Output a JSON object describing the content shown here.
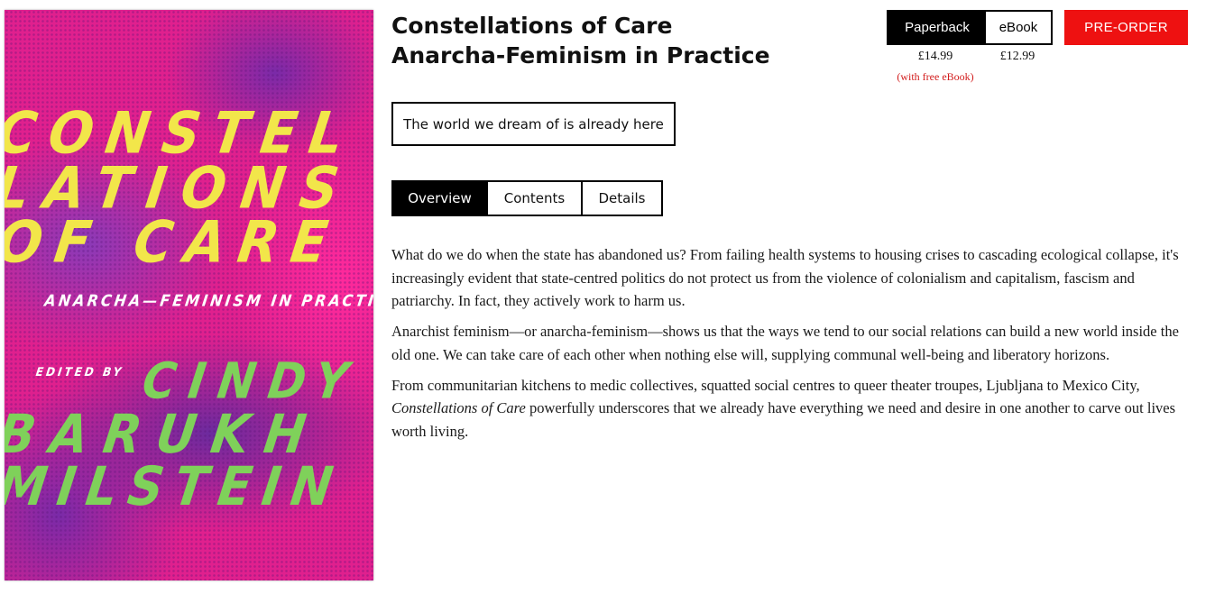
{
  "cover": {
    "line1": "CONSTEL",
    "line2": "LATIONS",
    "line3": "OF CARE",
    "subtitle": "ANARCHA—FEMINISM IN PRACTICE",
    "edited_by": "EDITED BY",
    "author_line1": "CINDY",
    "author_line2": "BARUKH",
    "author_line3": "MILSTEIN",
    "colors": {
      "background": "#e0208e",
      "title": "#f2e64a",
      "author": "#7fd15a"
    }
  },
  "book": {
    "title": "Constellations of Care",
    "subtitle": "Anarcha-Feminism in Practice",
    "tagline": "The world we dream of is already here"
  },
  "formats": {
    "paperback_label": "Paperback",
    "ebook_label": "eBook",
    "selected": "Paperback",
    "paperback_price": "£14.99",
    "ebook_price": "£12.99",
    "paperback_note": "(with free eBook)"
  },
  "actions": {
    "preorder_label": "PRE-ORDER",
    "preorder_color": "#ee1111"
  },
  "tabs": {
    "items": [
      {
        "label": "Overview",
        "active": true
      },
      {
        "label": "Contents",
        "active": false
      },
      {
        "label": "Details",
        "active": false
      }
    ]
  },
  "overview": {
    "p1": "What do we do when the state has abandoned us? From failing health systems to housing crises to cascading ecological collapse, it's increasingly evident that state-centred politics do not protect us from the violence of colonialism and capitalism, fascism and patriarchy. In fact, they actively work to harm us.",
    "p2": "Anarchist feminism—or anarcha-feminism—shows us that the ways we tend to our social relations can build a new world inside the old one. We can take care of each other when nothing else will, supplying communal well-being and liberatory horizons.",
    "p3_start": "From communitarian kitchens to medic collectives, squatted social centres to queer theater troupes, Ljubljana to Mexico City, ",
    "p3_title": "Constellations of Care",
    "p3_end": " powerfully underscores that we already have everything we need and desire in one another to carve out lives worth living."
  }
}
